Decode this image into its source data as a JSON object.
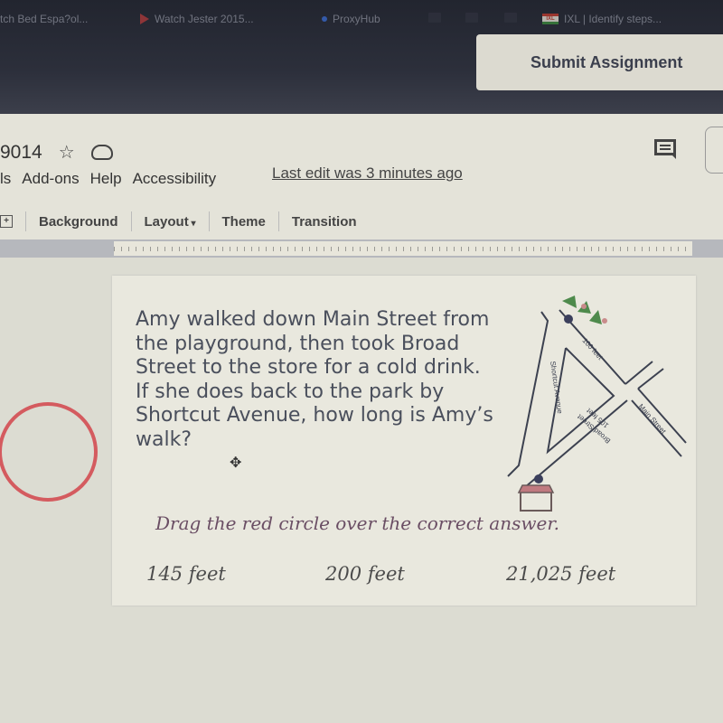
{
  "browser": {
    "bookmarks": [
      {
        "label": "tch Bed Espa?ol...",
        "icon": "page-icon"
      },
      {
        "label": "Watch Jester 2015...",
        "icon": "video-play-icon"
      },
      {
        "label": "ProxyHub",
        "icon": "dot-icon"
      },
      {
        "label": "",
        "icon": "folder-icon"
      },
      {
        "label": "",
        "icon": "folder-icon"
      },
      {
        "label": "",
        "icon": "folder-icon"
      },
      {
        "label": "IXL | Identify steps...",
        "icon": "ixl-icon"
      }
    ],
    "submit_label": "Submit Assignment"
  },
  "slides": {
    "doc_title": "9014",
    "menu": [
      "ls",
      "Add-ons",
      "Help",
      "Accessibility"
    ],
    "last_edit": "Last edit was 3 minutes ago",
    "toolbar": {
      "background": "Background",
      "layout": "Layout",
      "theme": "Theme",
      "transition": "Transition"
    }
  },
  "slide": {
    "question": "Amy walked down Main Street from the playground, then took Broad Street to the store for a cold drink.  If she does back to the park by Shortcut Avenue, how long is Amy’s walk?",
    "instruction": "Drag the red circle over the correct answer.",
    "answers": [
      "145 feet",
      "200 feet",
      "21,025 feet"
    ],
    "map": {
      "street_labels": {
        "shortcut": "Shortcut Avenue",
        "main": "Main Street",
        "broad": "Broad Street",
        "leg1": "100 feet",
        "leg2": "105 feet"
      }
    }
  },
  "colors": {
    "circle": "#d45b5f",
    "instruction": "#6a4e64"
  }
}
